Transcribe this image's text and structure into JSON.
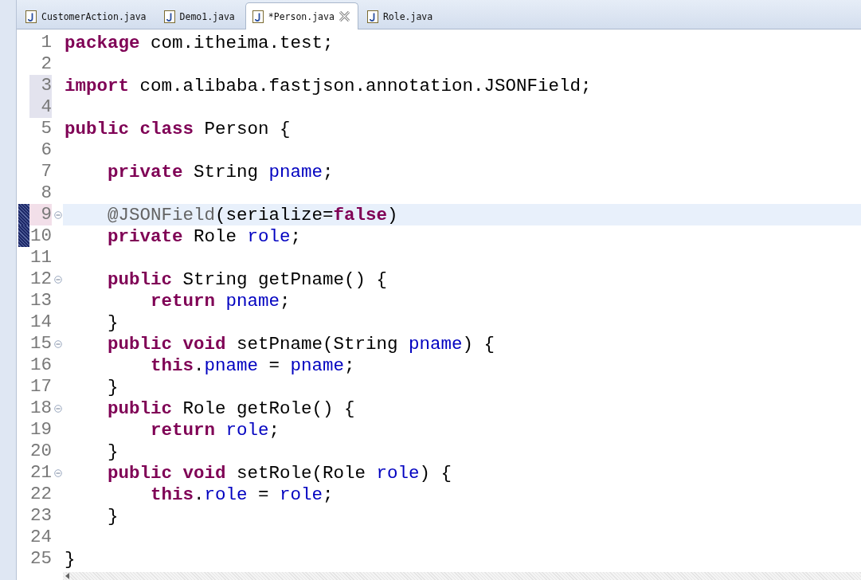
{
  "tabs": [
    {
      "label": "CustomerAction.java",
      "selected": false
    },
    {
      "label": "Demo1.java",
      "selected": false
    },
    {
      "label": "*Person.java",
      "selected": true
    },
    {
      "label": "Role.java",
      "selected": false
    }
  ],
  "lines": [
    {
      "number": "1",
      "current": false,
      "changed": false,
      "range_marked": false,
      "foldable": false,
      "tokens": [
        {
          "text": "package",
          "kind": "keyword"
        },
        {
          "text": " com.itheima.test;",
          "kind": "text"
        }
      ]
    },
    {
      "number": "2",
      "current": false,
      "changed": false,
      "range_marked": false,
      "foldable": false
    },
    {
      "number": "3",
      "current": false,
      "changed": false,
      "range_marked": true,
      "foldable": false,
      "tokens": [
        {
          "text": "import",
          "kind": "keyword"
        },
        {
          "text": " com.alibaba.fastjson.annotation.JSONField;",
          "kind": "text"
        }
      ]
    },
    {
      "number": "4",
      "current": false,
      "changed": false,
      "range_marked": true,
      "foldable": false
    },
    {
      "number": "5",
      "current": false,
      "changed": false,
      "range_marked": false,
      "foldable": false,
      "tokens": [
        {
          "text": "public",
          "kind": "keyword"
        },
        {
          "text": " class",
          "kind": "keyword"
        },
        {
          "text": " Person {",
          "kind": "text"
        }
      ]
    },
    {
      "number": "6",
      "current": false,
      "changed": false,
      "range_marked": false,
      "foldable": false
    },
    {
      "number": "7",
      "current": false,
      "changed": false,
      "range_marked": false,
      "foldable": false,
      "tokens": [
        {
          "text": "    private",
          "kind": "keyword"
        },
        {
          "text": " String ",
          "kind": "text"
        },
        {
          "text": "pname",
          "kind": "field"
        },
        {
          "text": ";",
          "kind": "text"
        }
      ]
    },
    {
      "number": "8",
      "current": false,
      "changed": false,
      "range_marked": false,
      "foldable": false
    },
    {
      "number": "9",
      "current": true,
      "changed": true,
      "range_marked": false,
      "foldable": true,
      "tokens": [
        {
          "text": "    @JSONField",
          "kind": "annotation"
        },
        {
          "text": "(serialize=",
          "kind": "text"
        },
        {
          "text": "false",
          "kind": "keyword"
        },
        {
          "text": ")",
          "kind": "text"
        }
      ]
    },
    {
      "number": "10",
      "current": false,
      "changed": true,
      "range_marked": false,
      "foldable": false,
      "tokens": [
        {
          "text": "    private",
          "kind": "keyword"
        },
        {
          "text": " Role ",
          "kind": "text"
        },
        {
          "text": "role",
          "kind": "field"
        },
        {
          "text": ";",
          "kind": "text"
        }
      ]
    },
    {
      "number": "11",
      "current": false,
      "changed": false,
      "range_marked": false,
      "foldable": false
    },
    {
      "number": "12",
      "current": false,
      "changed": false,
      "range_marked": false,
      "foldable": true,
      "tokens": [
        {
          "text": "    public",
          "kind": "keyword"
        },
        {
          "text": " String getPname() {",
          "kind": "text"
        }
      ]
    },
    {
      "number": "13",
      "current": false,
      "changed": false,
      "range_marked": false,
      "foldable": false,
      "tokens": [
        {
          "text": "        return",
          "kind": "keyword"
        },
        {
          "text": " pname",
          "kind": "field"
        },
        {
          "text": ";",
          "kind": "text"
        }
      ]
    },
    {
      "number": "14",
      "current": false,
      "changed": false,
      "range_marked": false,
      "foldable": false,
      "tokens": [
        {
          "text": "    }",
          "kind": "text"
        }
      ]
    },
    {
      "number": "15",
      "current": false,
      "changed": false,
      "range_marked": false,
      "foldable": true,
      "tokens": [
        {
          "text": "    public",
          "kind": "keyword"
        },
        {
          "text": " void",
          "kind": "keyword"
        },
        {
          "text": " setPname(String ",
          "kind": "text"
        },
        {
          "text": "pname",
          "kind": "field"
        },
        {
          "text": ") {",
          "kind": "text"
        }
      ]
    },
    {
      "number": "16",
      "current": false,
      "changed": false,
      "range_marked": false,
      "foldable": false,
      "tokens": [
        {
          "text": "        this",
          "kind": "keyword"
        },
        {
          "text": ".",
          "kind": "text"
        },
        {
          "text": "pname",
          "kind": "field"
        },
        {
          "text": " = ",
          "kind": "text"
        },
        {
          "text": "pname",
          "kind": "field"
        },
        {
          "text": ";",
          "kind": "text"
        }
      ]
    },
    {
      "number": "17",
      "current": false,
      "changed": false,
      "range_marked": false,
      "foldable": false,
      "tokens": [
        {
          "text": "    }",
          "kind": "text"
        }
      ]
    },
    {
      "number": "18",
      "current": false,
      "changed": false,
      "range_marked": false,
      "foldable": true,
      "tokens": [
        {
          "text": "    public",
          "kind": "keyword"
        },
        {
          "text": " Role getRole() {",
          "kind": "text"
        }
      ]
    },
    {
      "number": "19",
      "current": false,
      "changed": false,
      "range_marked": false,
      "foldable": false,
      "tokens": [
        {
          "text": "        return",
          "kind": "keyword"
        },
        {
          "text": " role",
          "kind": "field"
        },
        {
          "text": ";",
          "kind": "text"
        }
      ]
    },
    {
      "number": "20",
      "current": false,
      "changed": false,
      "range_marked": false,
      "foldable": false,
      "tokens": [
        {
          "text": "    }",
          "kind": "text"
        }
      ]
    },
    {
      "number": "21",
      "current": false,
      "changed": false,
      "range_marked": false,
      "foldable": true,
      "tokens": [
        {
          "text": "    public",
          "kind": "keyword"
        },
        {
          "text": " void",
          "kind": "keyword"
        },
        {
          "text": " setRole(Role ",
          "kind": "text"
        },
        {
          "text": "role",
          "kind": "field"
        },
        {
          "text": ") {",
          "kind": "text"
        }
      ]
    },
    {
      "number": "22",
      "current": false,
      "changed": false,
      "range_marked": false,
      "foldable": false,
      "tokens": [
        {
          "text": "        this",
          "kind": "keyword"
        },
        {
          "text": ".",
          "kind": "text"
        },
        {
          "text": "role",
          "kind": "field"
        },
        {
          "text": " = ",
          "kind": "text"
        },
        {
          "text": "role",
          "kind": "field"
        },
        {
          "text": ";",
          "kind": "text"
        }
      ]
    },
    {
      "number": "23",
      "current": false,
      "changed": false,
      "range_marked": false,
      "foldable": false,
      "tokens": [
        {
          "text": "    }",
          "kind": "text"
        }
      ]
    },
    {
      "number": "24",
      "current": false,
      "changed": false,
      "range_marked": false,
      "foldable": false
    },
    {
      "number": "25",
      "current": false,
      "changed": false,
      "range_marked": false,
      "foldable": false,
      "tokens": [
        {
          "text": "}",
          "kind": "text"
        }
      ]
    }
  ]
}
